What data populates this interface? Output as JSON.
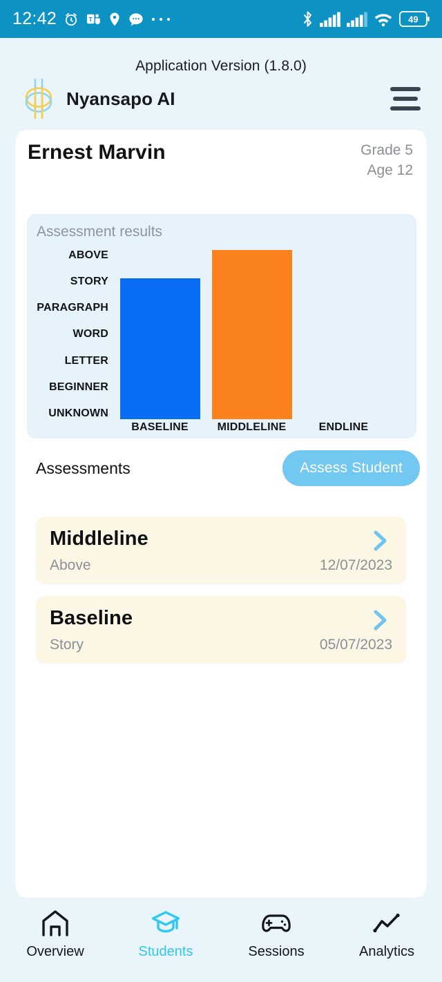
{
  "status_bar": {
    "time": "12:42",
    "left_icons": [
      "alarm-clock-icon",
      "teams-icon",
      "location-pin-icon",
      "chat-bubble-icon",
      "more-dots-icon"
    ],
    "right_icons": [
      "bluetooth-icon",
      "signal-bars-icon",
      "signal-bars-icon",
      "wifi-icon",
      "battery-icon"
    ],
    "battery_level": "49",
    "background_color": "#0c93c4"
  },
  "header": {
    "app_version": "Application Version (1.8.0)",
    "brand_name": "Nyansapo AI",
    "logo_icon": "nyansapo-logo-icon",
    "menu_icon": "hamburger-menu-icon"
  },
  "student": {
    "name": "Ernest Marvin",
    "grade": "Grade 5",
    "age": "Age 12"
  },
  "chart_data": {
    "type": "bar",
    "title": "Assessment results",
    "categories": [
      "BASELINE",
      "MIDDLELINE",
      "ENDLINE"
    ],
    "values": [
      5,
      6,
      0
    ],
    "value_labels": [
      "STORY",
      "ABOVE",
      ""
    ],
    "ylabel": "",
    "xlabel": "",
    "ytick_labels": [
      "ABOVE",
      "STORY",
      "PARAGRAPH",
      "WORD",
      "LETTER",
      "BEGINNER",
      "UNKNOWN"
    ],
    "ylim": [
      0,
      6
    ],
    "grid": false,
    "legend": "none",
    "bar_colors": [
      "#0a6ef5",
      "#fa811b",
      "transparent"
    ],
    "plot_background": "#e7f3fb"
  },
  "assessments_section": {
    "title": "Assessments",
    "action_label": "Assess Student",
    "action_color": "#73c8f2",
    "items": [
      {
        "title": "Middleline",
        "level": "Above",
        "date": "12/07/2023",
        "chevron_icon": "chevron-right-icon"
      },
      {
        "title": "Baseline",
        "level": "Story",
        "date": "05/07/2023",
        "chevron_icon": "chevron-right-icon"
      }
    ]
  },
  "bottom_nav": {
    "active_color": "#2ec8f0",
    "items": [
      {
        "label": "Overview",
        "icon": "home-icon",
        "active": false
      },
      {
        "label": "Students",
        "icon": "graduation-cap-icon",
        "active": true
      },
      {
        "label": "Sessions",
        "icon": "game-controller-icon",
        "active": false
      },
      {
        "label": "Analytics",
        "icon": "line-chart-icon",
        "active": false
      }
    ]
  }
}
